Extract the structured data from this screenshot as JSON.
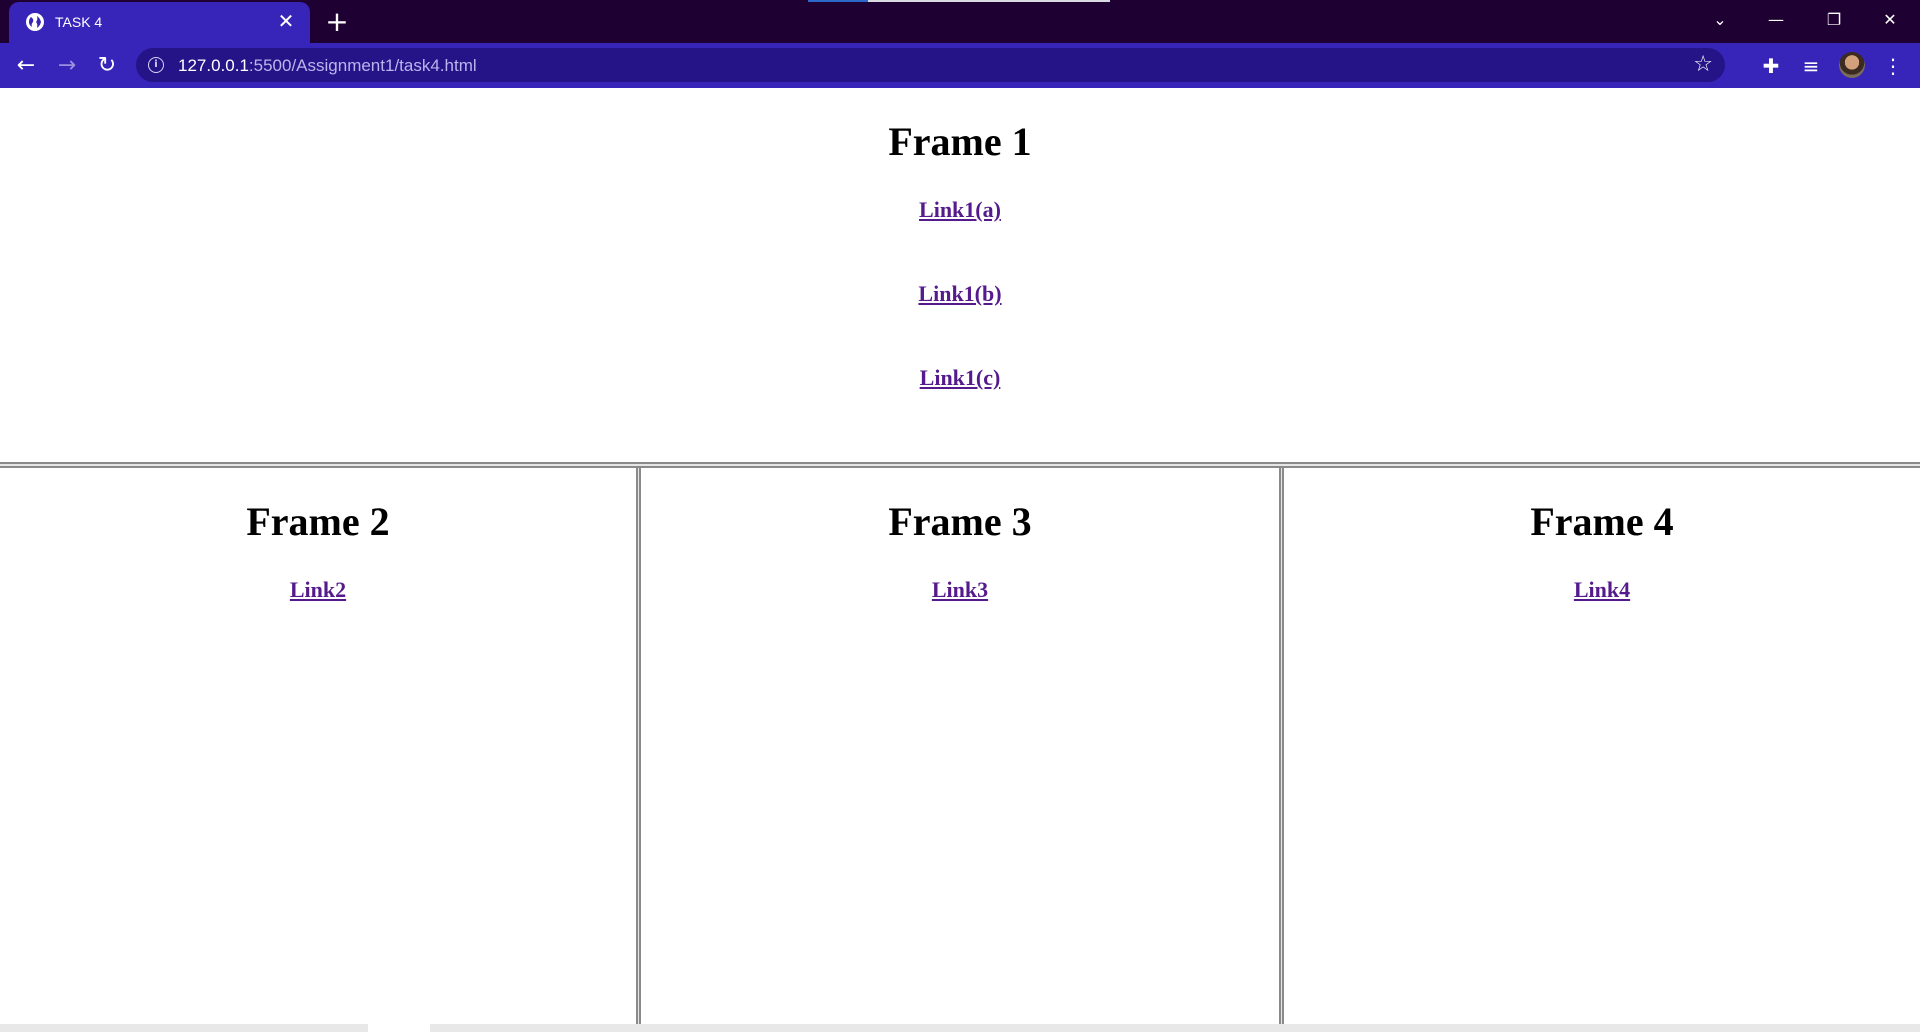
{
  "browser": {
    "tab": {
      "title": "TASK 4",
      "favicon": "globe-icon",
      "close_glyph": "✕"
    },
    "new_tab_glyph": "+",
    "window_controls": {
      "tab_search_glyph": "⌄",
      "minimize_glyph": "—",
      "restore_glyph": "❐",
      "close_glyph": "✕"
    },
    "nav": {
      "back_glyph": "←",
      "forward_glyph": "→",
      "reload_glyph": "↻"
    },
    "address_bar": {
      "info_glyph": "i",
      "url_host": "127.0.0.1",
      "url_rest": ":5500/Assignment1/task4.html",
      "bookmark_glyph": "☆"
    },
    "toolbar_icons": {
      "extensions_glyph": "✚",
      "media_glyph": "≡",
      "menu_glyph": "⋮"
    },
    "colors": {
      "titlebar": "#1f0033",
      "toolbar": "#3724b8",
      "omnibox": "#251487",
      "visited_link": "#551a8b"
    }
  },
  "page": {
    "frame1": {
      "heading": "Frame 1",
      "links": [
        "Link1(a)",
        "Link1(b)",
        "Link1(c)"
      ]
    },
    "frame2": {
      "heading": "Frame 2",
      "link": "Link2"
    },
    "frame3": {
      "heading": "Frame 3",
      "link": "Link3"
    },
    "frame4": {
      "heading": "Frame 4",
      "link": "Link4"
    }
  }
}
